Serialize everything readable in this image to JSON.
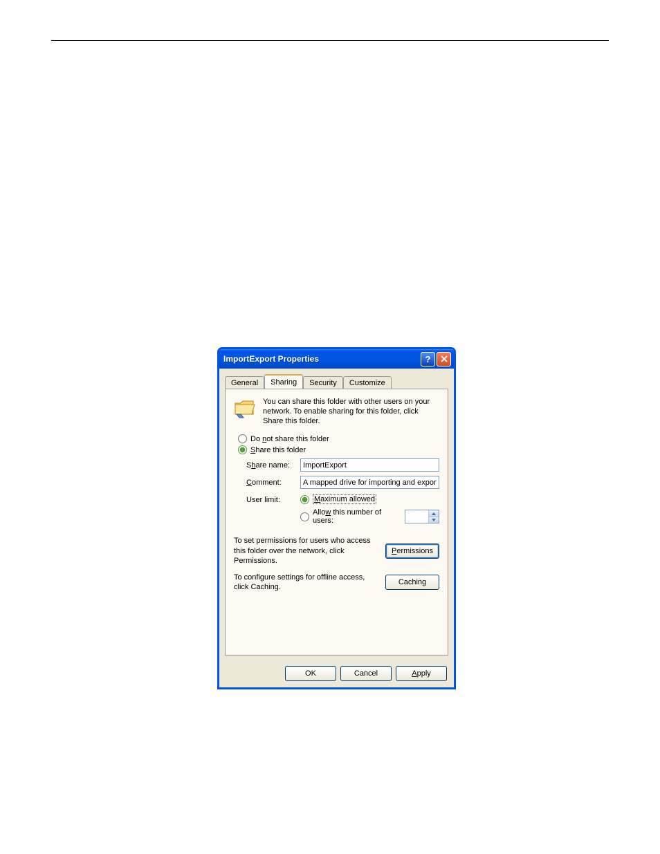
{
  "dialog": {
    "title": "ImportExport Properties",
    "tabs": [
      "General",
      "Sharing",
      "Security",
      "Customize"
    ],
    "intro": "You can share this folder with other users on your network.  To enable sharing for this folder, click Share this folder.",
    "radios": {
      "not_share": "Do not share this folder",
      "share": "Share this folder"
    },
    "fields": {
      "share_name_label": "Share name:",
      "share_name_value": "ImportExport",
      "comment_label": "Comment:",
      "comment_value": "A mapped drive for importing and exporting file"
    },
    "user_limit": {
      "label": "User limit:",
      "max": "Maximum allowed",
      "allow_n": "Allow this number of users:"
    },
    "actions": {
      "perm_text": "To set permissions for users who access this folder over the network, click Permissions.",
      "perm_btn": "Permissions",
      "cache_text": "To configure settings for offline access, click Caching.",
      "cache_btn": "Caching"
    },
    "buttons": {
      "ok": "OK",
      "cancel": "Cancel",
      "apply": "Apply"
    }
  }
}
